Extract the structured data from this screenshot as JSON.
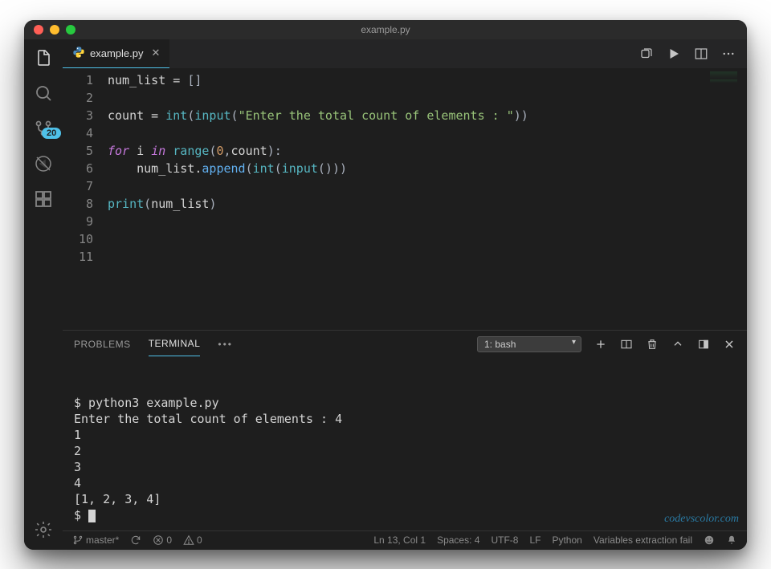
{
  "window": {
    "title": "example.py"
  },
  "activity": {
    "badge": "20"
  },
  "tab": {
    "filename": "example.py"
  },
  "code": {
    "lines": [
      [
        {
          "c": "tok-var",
          "t": "num_list"
        },
        {
          "c": "tok-op",
          "t": " = "
        },
        {
          "c": "tok-punct",
          "t": "[]"
        }
      ],
      [],
      [
        {
          "c": "tok-var",
          "t": "count"
        },
        {
          "c": "tok-op",
          "t": " = "
        },
        {
          "c": "tok-builtin",
          "t": "int"
        },
        {
          "c": "tok-punct",
          "t": "("
        },
        {
          "c": "tok-builtin",
          "t": "input"
        },
        {
          "c": "tok-punct",
          "t": "("
        },
        {
          "c": "tok-str",
          "t": "\"Enter the total count of elements : \""
        },
        {
          "c": "tok-punct",
          "t": "))"
        }
      ],
      [],
      [
        {
          "c": "tok-kw",
          "t": "for"
        },
        {
          "c": "",
          "t": " i "
        },
        {
          "c": "tok-kw",
          "t": "in"
        },
        {
          "c": "",
          "t": " "
        },
        {
          "c": "tok-builtin",
          "t": "range"
        },
        {
          "c": "tok-punct",
          "t": "("
        },
        {
          "c": "tok-num",
          "t": "0"
        },
        {
          "c": "tok-punct",
          "t": ","
        },
        {
          "c": "tok-var",
          "t": "count"
        },
        {
          "c": "tok-punct",
          "t": "):"
        }
      ],
      [
        {
          "c": "",
          "t": "    num_list."
        },
        {
          "c": "tok-fn",
          "t": "append"
        },
        {
          "c": "tok-punct",
          "t": "("
        },
        {
          "c": "tok-builtin",
          "t": "int"
        },
        {
          "c": "tok-punct",
          "t": "("
        },
        {
          "c": "tok-builtin",
          "t": "input"
        },
        {
          "c": "tok-punct",
          "t": "()))"
        }
      ],
      [],
      [
        {
          "c": "tok-builtin",
          "t": "print"
        },
        {
          "c": "tok-punct",
          "t": "("
        },
        {
          "c": "tok-var",
          "t": "num_list"
        },
        {
          "c": "tok-punct",
          "t": ")"
        }
      ],
      [],
      [],
      []
    ]
  },
  "panel": {
    "tabs": {
      "problems": "PROBLEMS",
      "terminal": "TERMINAL"
    },
    "select": "1: bash"
  },
  "terminal": {
    "lines": [
      "$ python3 example.py",
      "Enter the total count of elements : 4",
      "1",
      "2",
      "3",
      "4",
      "[1, 2, 3, 4]"
    ],
    "prompt": "$ "
  },
  "watermark": "codevscolor.com",
  "status": {
    "branch": "master*",
    "errors": "0",
    "warnings": "0",
    "cursor": "Ln 13, Col 1",
    "spaces": "Spaces: 4",
    "encoding": "UTF-8",
    "eol": "LF",
    "lang": "Python",
    "msg": "Variables extraction fail"
  }
}
